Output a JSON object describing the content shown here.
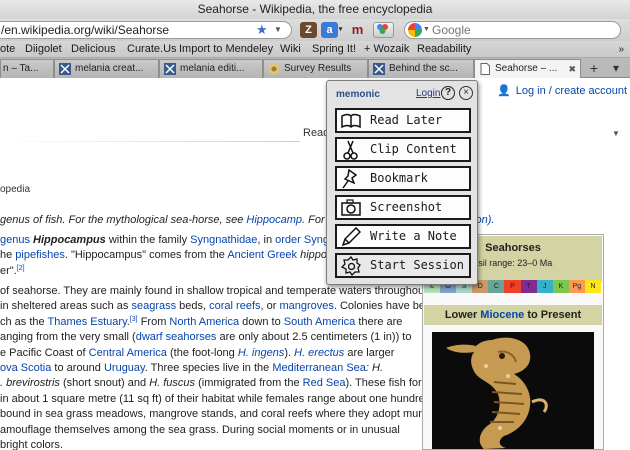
{
  "window": {
    "title": "Seahorse - Wikipedia, the free encyclopedia"
  },
  "nav": {
    "url": "/en.wikipedia.org/wiki/Seahorse",
    "search_placeholder": "Google"
  },
  "bookmarks": [
    "ote",
    "Diigolet",
    "Delicious",
    "Curate.Us",
    "Import to Mendeley",
    "Wiki",
    "Spring It!",
    "+ Wozaik",
    "Readability"
  ],
  "tabs": [
    {
      "label": "n – Ta..."
    },
    {
      "label": "melania creat..."
    },
    {
      "label": "melania editi..."
    },
    {
      "label": "Survey Results"
    },
    {
      "label": "Behind the sc..."
    },
    {
      "label": "Seahorse – ...",
      "active": true
    }
  ],
  "page": {
    "login_link": "Log in / create account",
    "read_tab": "Read",
    "tagline": "opedia",
    "hatnote": {
      "pre": "genus of fish. For the mythological sea-horse, see ",
      "link": "Hippocamp",
      "mid": ". For other",
      "tail": "tion)."
    },
    "para1": {
      "l1a": " genus ",
      "l1b": "Hippocampus",
      "l1c": " within the family ",
      "l1d": "Syngnathidae",
      "l1e": ", in ",
      "l1f": "order Syngnat",
      "l2a": "he ",
      "l2b": "pipefishes",
      "l2c": ". \"Hippocampus\" comes from the ",
      "l2d": "Ancient Greek",
      "l2e": " hippos",
      " l2f": "",
      "l2f": " m",
      "l3a": "er\".",
      "l3b": "[2]"
    },
    "para2": {
      "l1": "of seahorse. They are mainly found in shallow tropical and temperate waters throughout",
      "l2a": "in sheltered areas such as ",
      "l2b": "seagrass",
      "l2c": " beds, ",
      "l2d": "coral reefs",
      "l2e": ", or ",
      "l2f": "mangroves",
      "l2g": ". Colonies have been",
      "l3a": "ch as the ",
      "l3b": "Thames Estuary",
      "l3c": ".",
      "l3d": "[3]",
      "l3e": " From ",
      "l3f": "North America",
      "l3g": " down to ",
      "l3h": "South America",
      "l3i": " there are",
      "l4a": "anging from the very small (",
      "l4b": "dwarf seahorses",
      "l4c": " are only about 2.5 centimeters (1 in)) to",
      "l5a": "e Pacific Coast of ",
      "l5b": "Central America",
      "l5c": " (the foot-long ",
      "l5d": "H. ingens",
      "l5e": "). ",
      "l5f": "H. erectus",
      "l5g": " are larger",
      "l6a": "ova Scotia",
      "l6b": " to around ",
      "l6c": "Uruguay",
      "l6d": ". Three species live in the ",
      "l6e": "Mediterranean Sea",
      "l6f": ": H.",
      "l7a": ". brevirostris",
      "l7b": " (short snout) and ",
      "l7c": "H. fuscus",
      "l7d": " (immigrated from the ",
      "l7e": "Red Sea",
      "l7f": "). These fish form",
      "l8": " in about 1 square metre (11 sq ft) of their habitat while females range about one hundred",
      "l9": "bound in sea grass meadows, mangrove stands, and coral reefs where they adopt murky",
      "l10": "amouflage themselves among the sea grass. During social moments or in unusual",
      "l11": "bright colors."
    },
    "infobox": {
      "title": "Seahorses",
      "range_label": "ssil range: 23–0 Ma",
      "periods": [
        "Ɛ",
        "O",
        "S",
        "D",
        "C",
        "P",
        "T",
        "J",
        "K",
        "Pg",
        "N"
      ],
      "period_colors": [
        "#b3e1b6",
        "#7fa6cf",
        "#a6d8c9",
        "#cc9966",
        "#67a599",
        "#f04028",
        "#812b92",
        "#34b2c9",
        "#7fc64e",
        "#fd9a52",
        "#ffe619"
      ],
      "epoch_prefix": "Lower ",
      "epoch_link": "Miocene",
      "epoch_suffix": " to Present"
    }
  },
  "memonic": {
    "brand": "memonic",
    "login": "Login",
    "help": "?",
    "buttons": [
      {
        "label": "Read Later",
        "icon": "book-icon"
      },
      {
        "label": "Clip Content",
        "icon": "scissors-icon"
      },
      {
        "label": "Bookmark",
        "icon": "pushpin-icon"
      },
      {
        "label": "Screenshot",
        "icon": "camera-icon"
      },
      {
        "label": "Write a Note",
        "icon": "pencil-icon"
      },
      {
        "label": "Start Session",
        "icon": "gear-icon"
      }
    ]
  }
}
